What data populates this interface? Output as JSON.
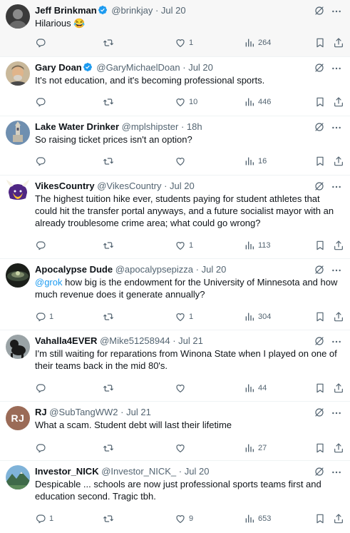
{
  "tweets": [
    {
      "name": "Jeff Brinkman",
      "verified": true,
      "handle": "@brinkjay",
      "date": "· Jul 20",
      "text": "Hilarious 😂",
      "replies": "",
      "retweets": "",
      "likes": "1",
      "views": "264",
      "highlighted": true
    },
    {
      "name": "Gary Doan",
      "verified": true,
      "handle": "@GaryMichaelDoan",
      "date": "· Jul 20",
      "text": "It's not education, and it's becoming professional sports.",
      "replies": "",
      "retweets": "",
      "likes": "10",
      "views": "446"
    },
    {
      "name": "Lake Water Drinker",
      "verified": false,
      "handle": "@mplshipster",
      "date": "· 18h",
      "text": "So raising ticket prices isn't an option?",
      "replies": "",
      "retweets": "",
      "likes": "",
      "views": "16"
    },
    {
      "name": "VikesCountry",
      "verified": false,
      "handle": "@VikesCountry",
      "date": "· Jul 20",
      "text": "The highest tuition hike ever, students paying for student athletes that could hit the transfer portal anyways, and a future socialist mayor with an already troublesome crime area; what could go wrong?",
      "replies": "",
      "retweets": "",
      "likes": "1",
      "views": "113"
    },
    {
      "name": "Apocalypse Dude",
      "verified": false,
      "handle": "@apocalypsepizza",
      "date": "· Jul 20",
      "mention": "@grok",
      "text": " how big is the endowment for the University of Minnesota and how much revenue does it generate annually?",
      "replies": "1",
      "retweets": "",
      "likes": "1",
      "views": "304"
    },
    {
      "name": "Vahalla4EVER",
      "verified": false,
      "handle": "@Mike51258944",
      "date": "· Jul 21",
      "text": "I'm still waiting for reparations from Winona State when I played on one of their teams back in the mid 80's.",
      "replies": "",
      "retweets": "",
      "likes": "",
      "views": "44"
    },
    {
      "name": "RJ",
      "verified": false,
      "handle": "@SubTangWW2",
      "date": "· Jul 21",
      "avatar_initials": "RJ",
      "text": "What a scam. Student debt will last their lifetime",
      "replies": "",
      "retweets": "",
      "likes": "",
      "views": "27"
    },
    {
      "name": "Investor_NICK",
      "verified": false,
      "handle": "@Investor_NICK_",
      "date": "· Jul 20",
      "text": "Despicable ... schools are now just professional sports teams first and education second. Tragic tbh.",
      "replies": "1",
      "retweets": "",
      "likes": "9",
      "views": "653"
    }
  ],
  "icons": {
    "verified": "verified-badge-icon",
    "grok": "grok-icon",
    "more": "more-icon",
    "reply": "reply-icon",
    "retweet": "retweet-icon",
    "like": "heart-icon",
    "views": "views-icon",
    "bookmark": "bookmark-icon",
    "share": "share-icon"
  },
  "colors": {
    "accent": "#1d9bf0",
    "muted": "#536471",
    "text": "#0f1419",
    "divider": "#eff3f4"
  }
}
